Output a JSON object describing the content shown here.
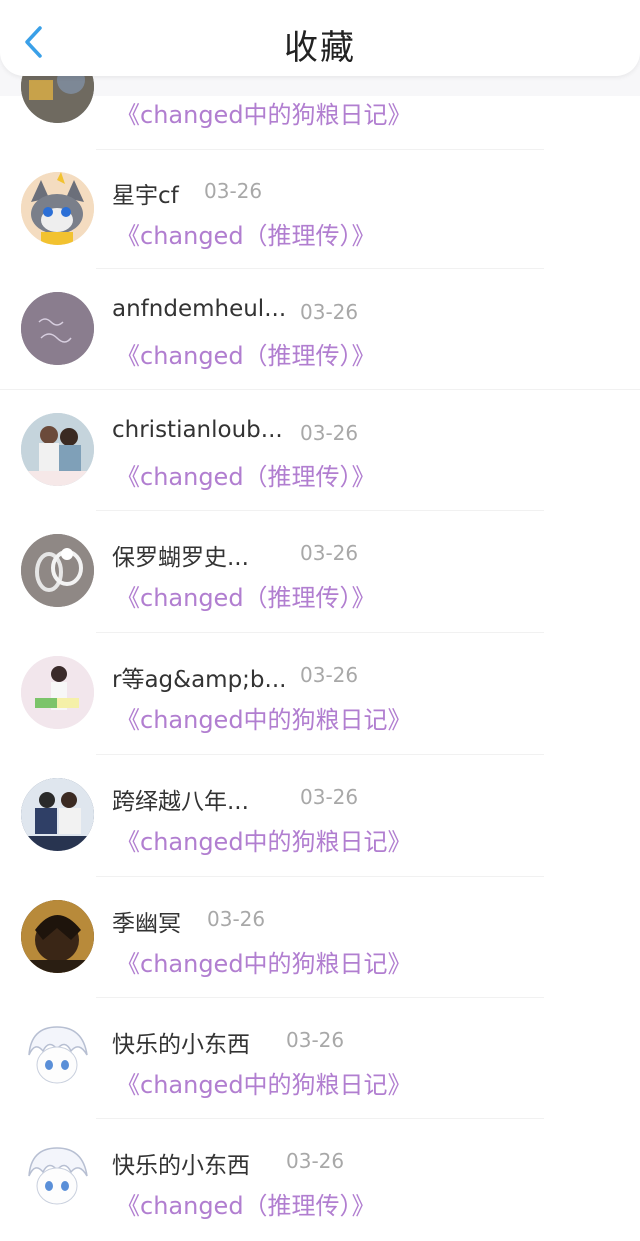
{
  "header": {
    "title": "收藏",
    "back_icon": "chevron-left-icon",
    "accent": "#3aa0e8"
  },
  "colors": {
    "book_title": "#b17ed0",
    "date": "#a8a8a8",
    "name": "#333333"
  },
  "items": [
    {
      "name": "",
      "date": "",
      "book": "《changed中的狗粮日记》",
      "avatar": "partial-avatar"
    },
    {
      "name": "星宇cf",
      "date": "03-26",
      "book": "《changed（推理传）》",
      "avatar": "cartoon-cat-avatar"
    },
    {
      "name": "anfndemheul...",
      "date": "03-26",
      "book": "《changed（推理传）》",
      "avatar": "purple-text-avatar"
    },
    {
      "name": "christianloub...",
      "date": "03-26",
      "book": "《changed（推理传）》",
      "avatar": "couple-photo-avatar"
    },
    {
      "name": "保罗蝴罗史...",
      "date": "03-26",
      "book": "《changed（推理传）》",
      "avatar": "rings-avatar"
    },
    {
      "name": "r等ag&amp;b...",
      "date": "03-26",
      "book": "《changed中的狗粮日记》",
      "avatar": "girl-photo-avatar"
    },
    {
      "name": "跨绎越八年...",
      "date": "03-26",
      "book": "《changed中的狗粮日记》",
      "avatar": "couple-sitting-avatar"
    },
    {
      "name": "季幽冥",
      "date": "03-26",
      "book": "《changed中的狗粮日记》",
      "avatar": "anime-boy-avatar"
    },
    {
      "name": "快乐的小东西",
      "date": "03-26",
      "book": "《changed中的狗粮日记》",
      "avatar": "white-anime-avatar"
    },
    {
      "name": "快乐的小东西",
      "date": "03-26",
      "book": "《changed（推理传）》",
      "avatar": "white-anime-avatar"
    }
  ]
}
